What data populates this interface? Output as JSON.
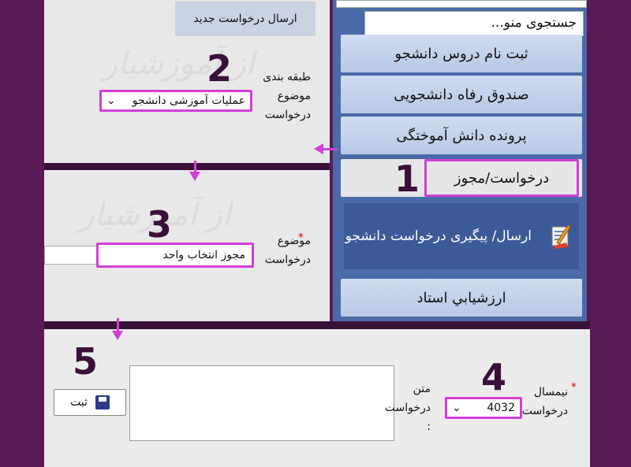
{
  "menu": {
    "search_placeholder": "جستجوی منو...",
    "items": [
      {
        "label": "ثبت نام دروس دانشجو"
      },
      {
        "label": "صندوق رفاه دانشجویی"
      },
      {
        "label": "پرونده دانش آموختگی"
      },
      {
        "label": "درخواست/مجوز"
      },
      {
        "label": "ارزشيابي استاد"
      }
    ],
    "submenu_label": "ارسال/ پیگیری درخواست دانشجو"
  },
  "form1": {
    "new_request_button": "ارسال درخواست جدید",
    "category_label": "طبقه بندی موضوع درخواست",
    "category_value": "عملیات آموزشی دانشجو"
  },
  "form2": {
    "subject_label": "موضوع درخواست",
    "subject_value": "مجوز انتخاب واحد",
    "required_mark": "*"
  },
  "form3": {
    "semester_label": "نیمسال درخواست",
    "semester_value": "4032",
    "text_label": "متن درخواست :",
    "save_button": "ثبت",
    "required_mark": "*"
  },
  "steps": {
    "s1": "1",
    "s2": "2",
    "s3": "3",
    "s4": "4",
    "s5": "5"
  },
  "watermark": "از آموزشیار",
  "colors": {
    "highlight": "#d23fd8",
    "frame": "#5a1a56",
    "menu_bg": "#4a6aa8",
    "submenu_bg": "#3d5a98"
  }
}
